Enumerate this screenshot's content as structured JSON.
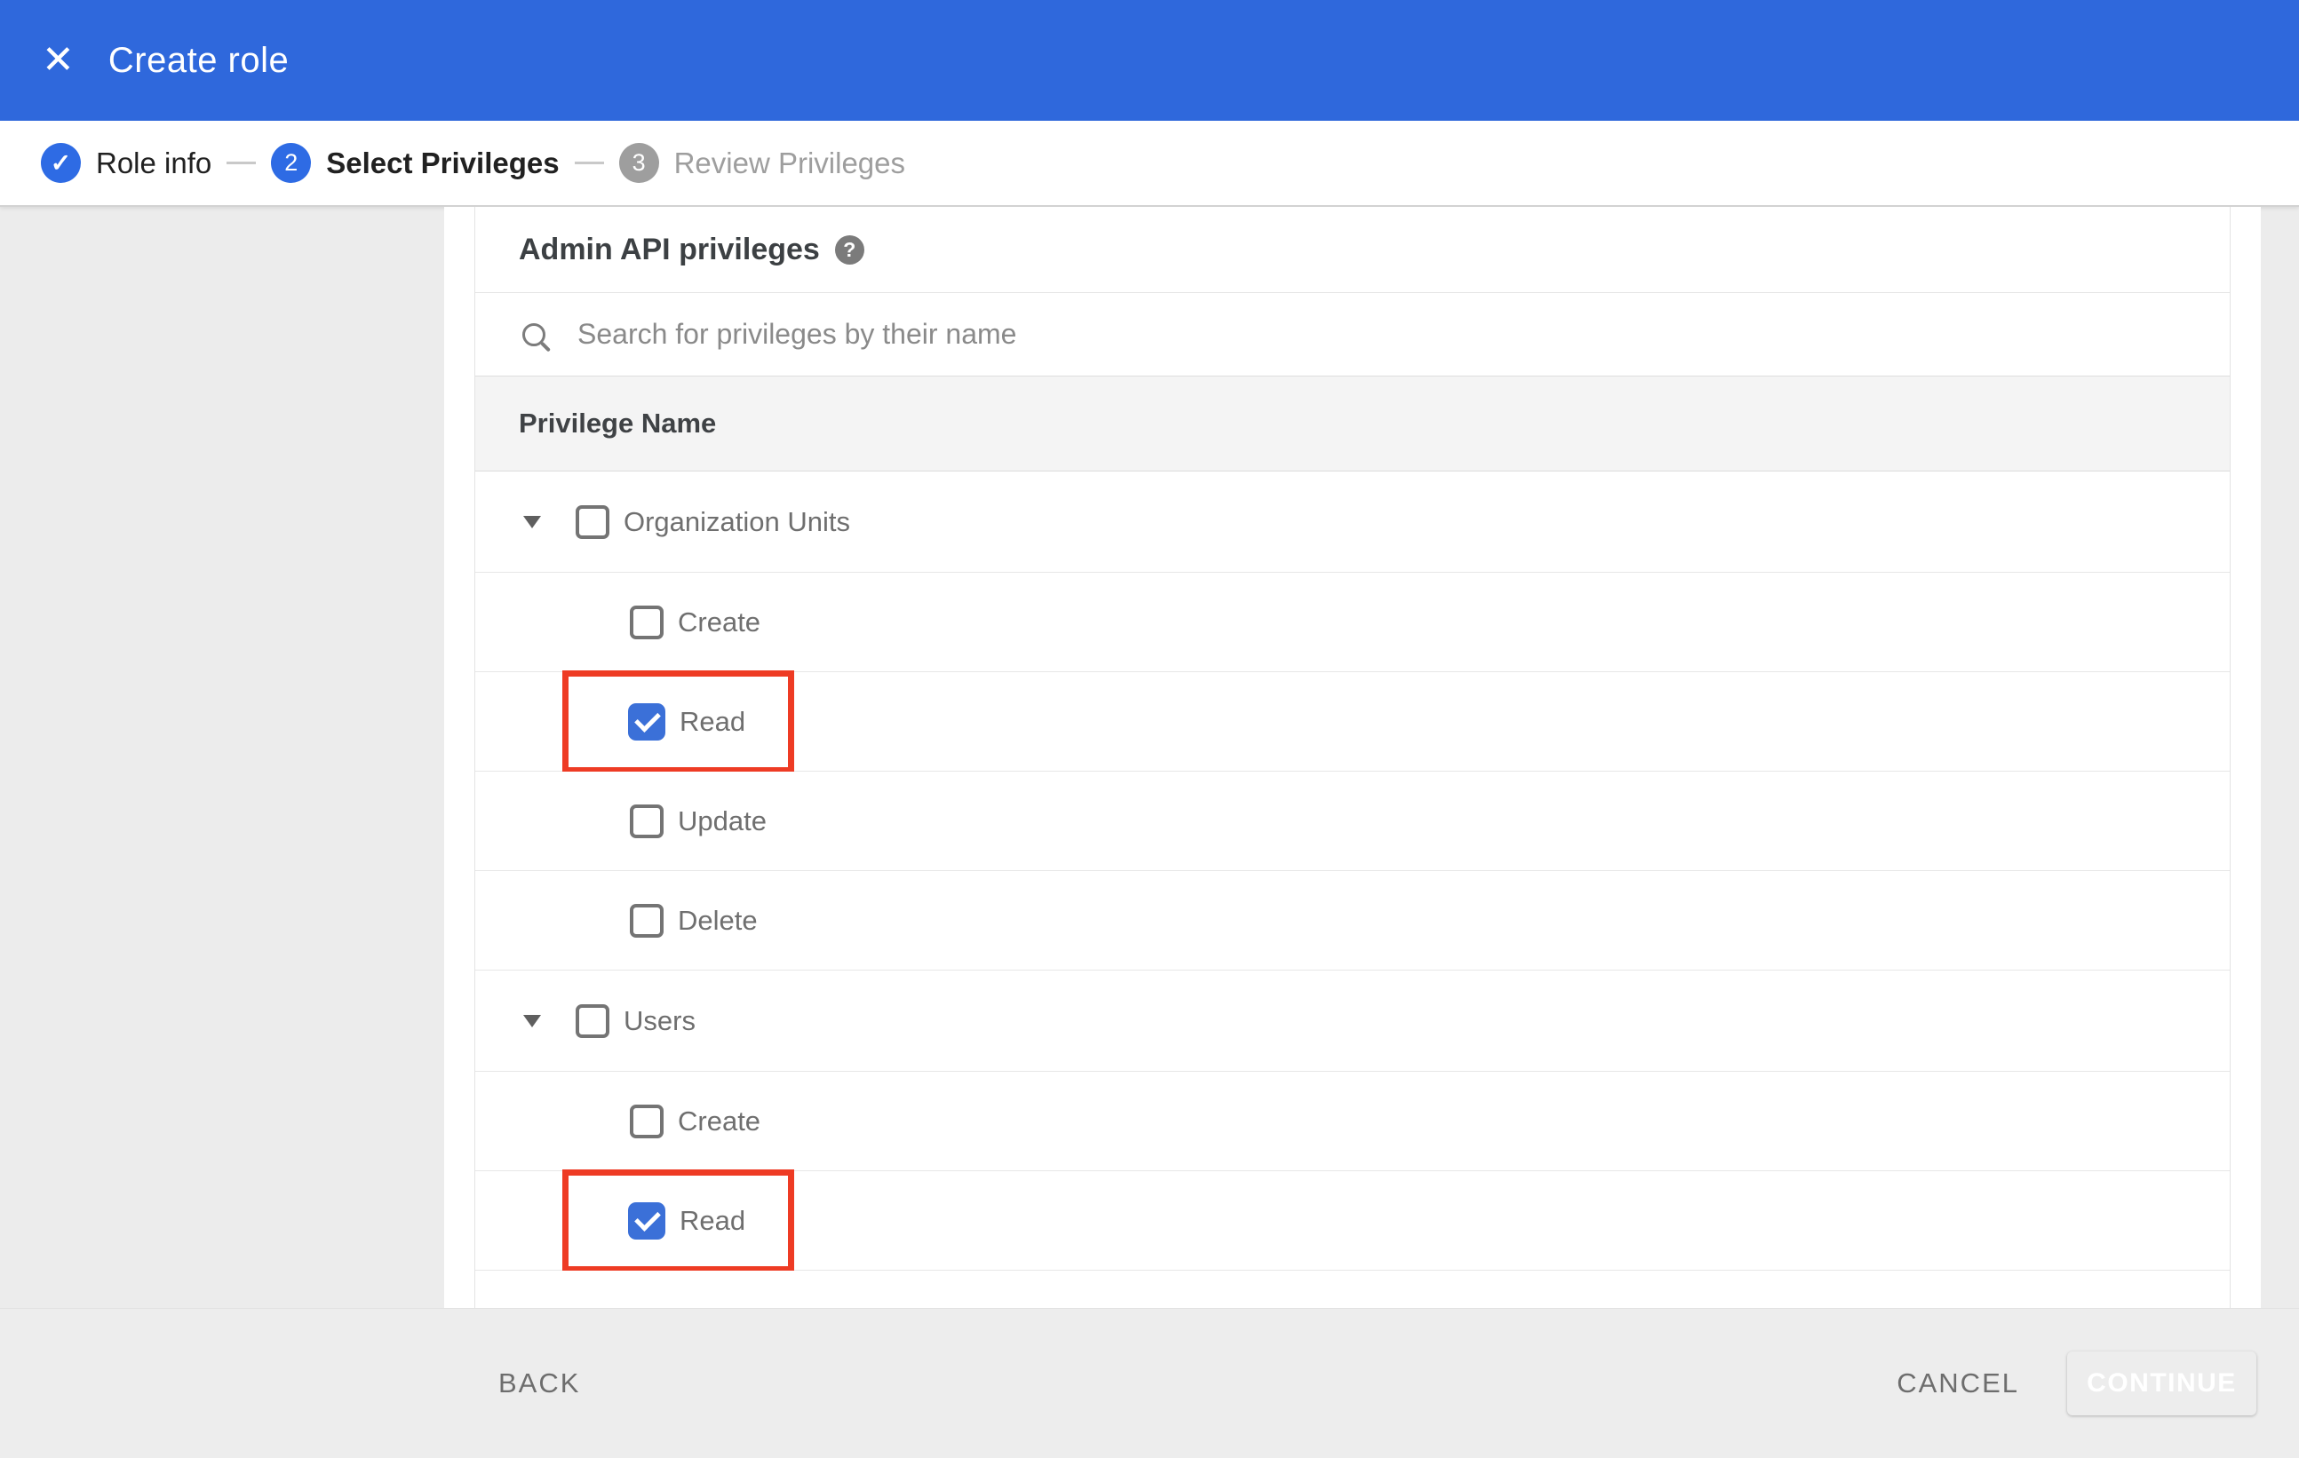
{
  "colors": {
    "appbar_blue": "#2f68dc",
    "step_blue": "#2e6be4",
    "step_gray": "#9e9e9e",
    "checkbox_blue": "#3b70d8",
    "continue_blue": "#2f6ad9",
    "annotation_red": "#ee3b24",
    "page_gray": "#ececec"
  },
  "header": {
    "title": "Create role",
    "close_glyph": "✕"
  },
  "stepper": {
    "check_glyph": "✓",
    "steps": [
      {
        "label": "Role info",
        "state": "complete",
        "number": ""
      },
      {
        "label": "Select Privileges",
        "state": "active",
        "number": "2"
      },
      {
        "label": "Review Privileges",
        "state": "inactive",
        "number": "3"
      }
    ]
  },
  "panel": {
    "heading": "Admin API privileges",
    "help_glyph": "?",
    "search_placeholder": "Search for privileges by their name",
    "column_header": "Privilege Name"
  },
  "privileges": [
    {
      "label": "Organization Units",
      "type": "group",
      "checked": false,
      "expanded": true,
      "highlighted": false
    },
    {
      "label": "Create",
      "type": "child",
      "checked": false,
      "highlighted": false
    },
    {
      "label": "Read",
      "type": "child",
      "checked": true,
      "highlighted": true
    },
    {
      "label": "Update",
      "type": "child",
      "checked": false,
      "highlighted": false
    },
    {
      "label": "Delete",
      "type": "child",
      "checked": false,
      "highlighted": false
    },
    {
      "label": "Users",
      "type": "group",
      "checked": false,
      "expanded": true,
      "highlighted": false
    },
    {
      "label": "Create",
      "type": "child",
      "checked": false,
      "highlighted": false
    },
    {
      "label": "Read",
      "type": "child",
      "checked": true,
      "highlighted": true
    }
  ],
  "footer": {
    "back_label": "BACK",
    "cancel_label": "CANCEL",
    "continue_label": "CONTINUE"
  }
}
